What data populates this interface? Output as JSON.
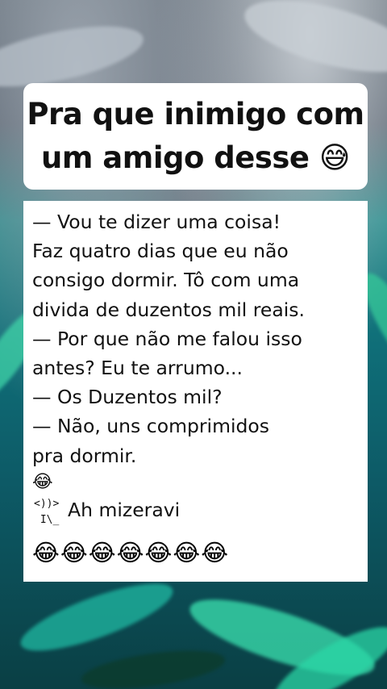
{
  "title": {
    "line1": "Pra que inimigo com",
    "line2": "um amigo desse 😅"
  },
  "joke": {
    "lines": [
      "— Vou te dizer uma coisa!",
      "Faz quatro dias que eu não",
      "consigo dormir. Tô com uma",
      "divida de duzentos mil reais.",
      "— Por que não me falou isso",
      "antes? Eu te arrumo...",
      "— Os Duzentos mil?",
      "— Não, uns comprimidos",
      "pra dormir."
    ],
    "single_emoji": "😂",
    "ascii_face": "<))>\n I\\_",
    "face_caption": "Ah mizeravi",
    "laugh_row": "😂😂😂😂😂😂😂"
  }
}
